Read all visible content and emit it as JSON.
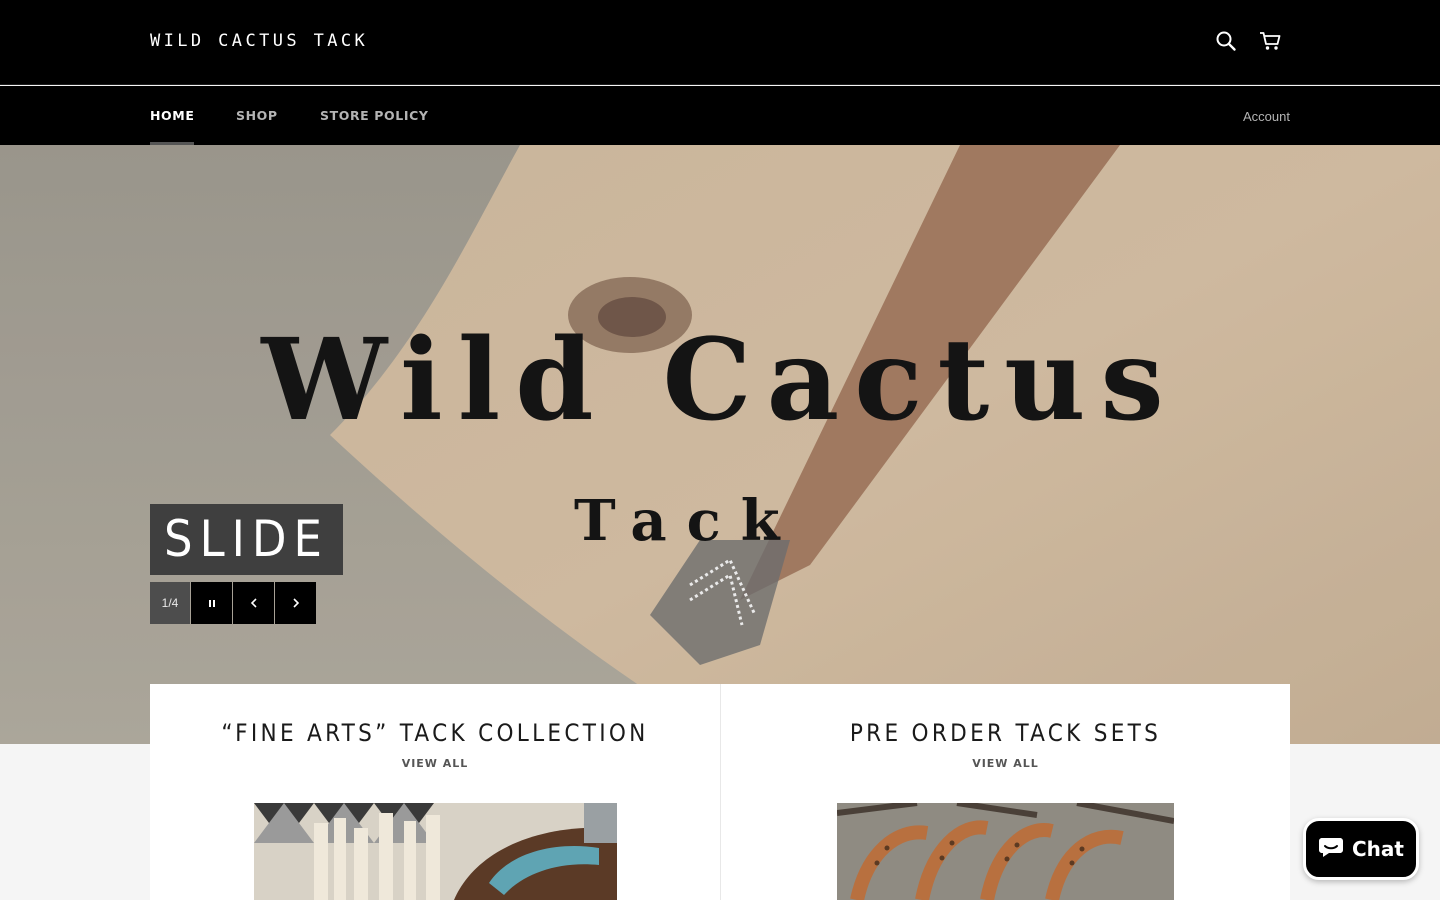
{
  "header": {
    "logo": "WILD CACTUS TACK",
    "icons": {
      "search": "search-icon",
      "cart": "cart-icon"
    }
  },
  "nav": {
    "items": [
      {
        "label": "HOME",
        "active": true
      },
      {
        "label": "SHOP",
        "active": false
      },
      {
        "label": "STORE POLICY",
        "active": false
      }
    ],
    "account": "Account"
  },
  "hero": {
    "title": "Wild Cactus",
    "subtitle": "Tack",
    "slide_label": "SLIDE",
    "counter": "1/4",
    "controls": {
      "pause": "pause-icon",
      "prev": "chevron-left-icon",
      "next": "chevron-right-icon"
    }
  },
  "collections": [
    {
      "title": "“FINE ARTS” TACK COLLECTION",
      "link": "VIEW ALL"
    },
    {
      "title": "PRE ORDER TACK SETS",
      "link": "VIEW ALL"
    }
  ],
  "chat": {
    "label": "Chat",
    "icon": "chat-bubble-icon"
  },
  "colors": {
    "header_bg": "#000000",
    "page_bg": "#f5f5f5",
    "accent": "#3f3f3f"
  }
}
